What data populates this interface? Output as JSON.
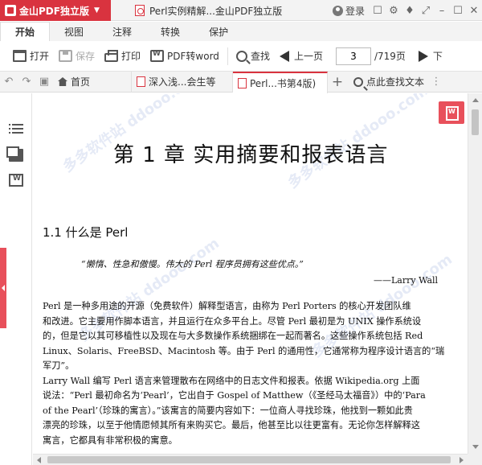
{
  "titlebar": {
    "app_name": "金山PDF独立版",
    "document_title": "Perl实例精解...金山PDF独立版",
    "login_label": "登录"
  },
  "menu": {
    "tabs": [
      "开始",
      "视图",
      "注释",
      "转换",
      "保护"
    ],
    "active": "开始"
  },
  "toolbar": {
    "open": "打开",
    "save": "保存",
    "print": "打印",
    "pdf_to_word": "PDF转word",
    "find": "查找",
    "prev_page": "上一页",
    "next_page": "下",
    "current_page": "3",
    "total_pages": "/719页"
  },
  "tabs": {
    "home": "首页",
    "doc1": "深入浅...会生等",
    "doc2": "Perl...书第4版)",
    "add": "+",
    "find_text": "点此查找文本"
  },
  "watermark_text": "多多软件站 ddooo.com",
  "document": {
    "chapter_title": "第 1 章   实用摘要和报表语言",
    "section_title": "1.1   什么是 Perl",
    "quote": "“懒惰、性急和傲慢。伟大的 Perl 程序员拥有这些优点。”",
    "quote_author": "——Larry Wall",
    "paragraphs": [
      "    Perl 是一种多用途的开源（免费软件）解释型语言，由称为 Perl Porters 的核心开发团队维",
      "和改进。它主要用作脚本语言，并且运行在众多平台上。尽管 Perl 最初是为 UNIX 操作系统设",
      "的，但是它以其可移植性以及现在与大多数操作系统捆绑在一起而著名。这些操作系统包括 Red",
      "Linux、Solaris、FreeBSD、Macintosh 等。由于 Perl 的通用性，它通常称为程序设计语言的“瑞",
      "军刀”。",
      "    Larry Wall 编写 Perl 语言来管理散布在网络中的日志文件和报表。依据 Wikipedia.org 上面",
      "说法：“Perl 最初命名为‘Pearl’，它出自于 Gospel of Matthew（《圣经马太福音》）中的‘Para",
      "of the Pearl’（珍珠的寓言）。”该寓言的简要内容如下：一位商人寻找珍珠，他找到一颗如此贵",
      "漂亮的珍珠，以至于他情愿倾其所有来购买它。最后，他甚至比以往更富有。无论你怎样解释这",
      "寓言，它都具有非常积极的寓意。"
    ]
  },
  "colors": {
    "brand_red": "#d9333f",
    "accent_red": "#e8505b"
  }
}
